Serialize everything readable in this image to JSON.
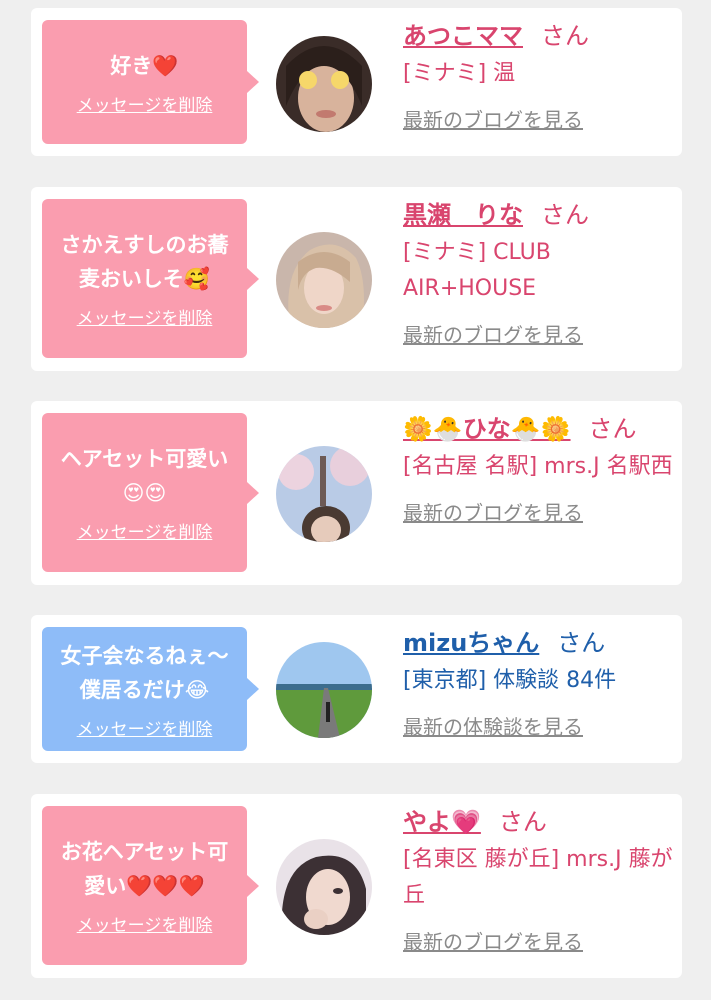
{
  "cards": [
    {
      "message": "好き❤️",
      "delete_label": "メッセージを削除",
      "name": "あつこママ",
      "honorific": "さん",
      "shop": "[ミナミ] 温",
      "link": "最新のブログを見る"
    },
    {
      "message": "さかえすしのお蕎麦おいしそ🥰",
      "delete_label": "メッセージを削除",
      "name": "黒瀬　りな",
      "honorific": "さん",
      "shop": "[ミナミ] CLUB AIR+HOUSE",
      "link": "最新のブログを見る"
    },
    {
      "message": "ヘアセット可愛い😍😍",
      "delete_label": "メッセージを削除",
      "name": "🌼🐣ひな🐣🌼",
      "honorific": "さん",
      "shop": "[名古屋 名駅] mrs.J 名駅西",
      "link": "最新のブログを見る"
    },
    {
      "message": "女子会なるねぇ〜僕居るだけ😂",
      "delete_label": "メッセージを削除",
      "name": "mizuちゃん",
      "honorific": "さん",
      "shop": "[東京都] 体験談 84件",
      "link": "最新の体験談を見る"
    },
    {
      "message": "お花ヘアセット可愛い❤️❤️❤️",
      "delete_label": "メッセージを削除",
      "name": "やよ💗",
      "honorific": "さん",
      "shop": "[名東区 藤が丘] mrs.J 藤が丘",
      "link": "最新のブログを見る"
    }
  ],
  "colors": {
    "page_bg": "#efefef",
    "bubble_pink": "#fa9daf",
    "bubble_blue": "#8ebcf8",
    "name_pink": "#d9456e",
    "name_blue": "#1f5faa",
    "link_gray": "#8a8a8a"
  }
}
